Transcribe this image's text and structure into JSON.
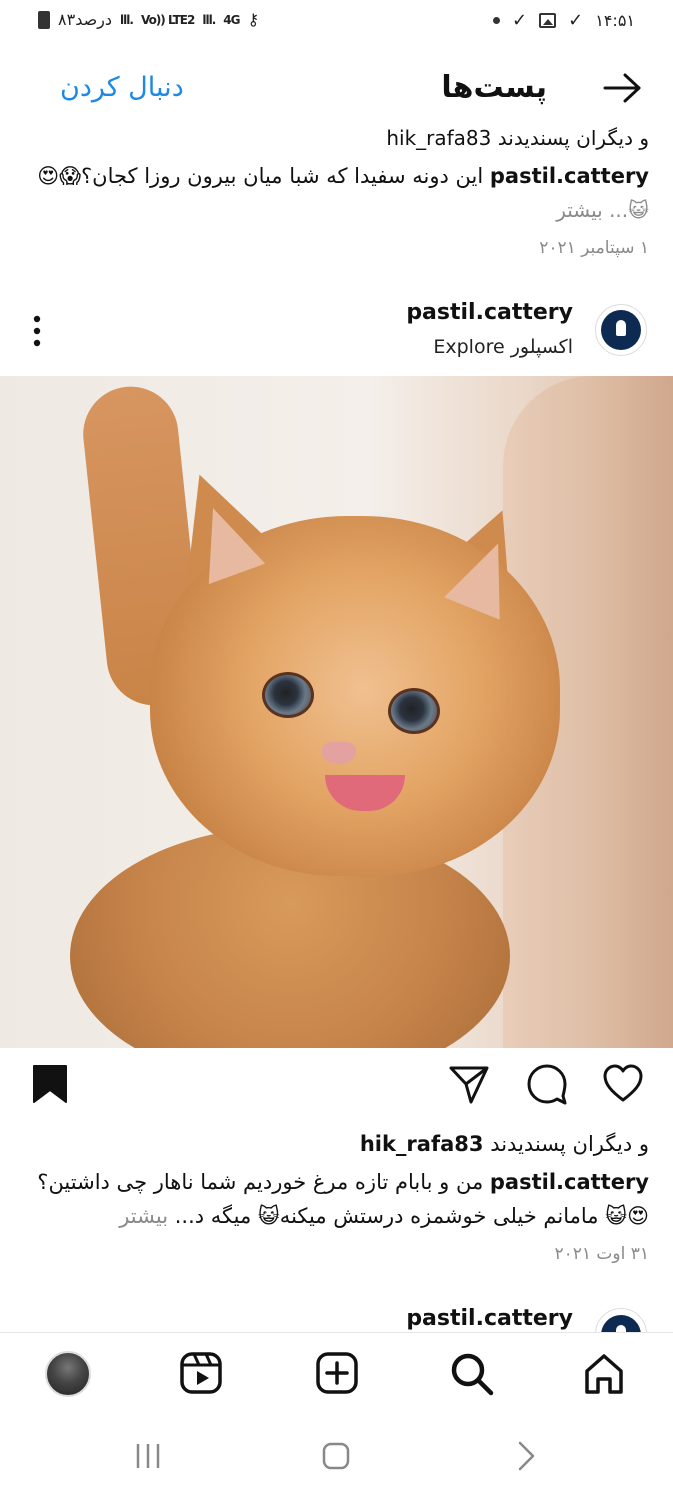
{
  "status_bar": {
    "battery": "۸۳درصد",
    "network_4g": "4G",
    "volte": "Vo)) LTE2",
    "time": "۱۴:۵۱",
    "icons": [
      "battery-icon",
      "signal-icon",
      "volte-icon",
      "4g-icon",
      "key-icon",
      "dot-icon",
      "check-icon",
      "gallery-icon",
      "check-icon"
    ]
  },
  "header": {
    "title": "پست‌ها",
    "follow_label": "دنبال کردن",
    "back_icon": "arrow-right-icon"
  },
  "prev_post": {
    "likes_partial": "و دیگران پسندیدند hik_rafa83",
    "caption_user": "pastil.cattery",
    "caption_text": "این دونه سفیدا که شبا میان بیرون روزا کجان؟😱😍",
    "caption_more": "😺... بیشتر",
    "date": "۱ سپتامبر ۲۰۲۱"
  },
  "post": {
    "username": "pastil.cattery",
    "location": "اکسپلور Explore",
    "avatar_label": "pastil.cattery",
    "likes_text": "و دیگران پسندیدند",
    "likes_user": "hik_rafa83",
    "caption_user": "pastil.cattery",
    "caption_line1": "من و بابام تازه مرغ خوردیم شما ناهار چی داشتین؟",
    "caption_line2": "😍😺 مامانم خیلی خوشمزه درستش میکنه😺 میگه د...",
    "caption_more": "بیشتر",
    "date": "۳۱ اوت ۲۰۲۱"
  },
  "next_post": {
    "username": "pastil.cattery"
  },
  "colors": {
    "accent_blue": "#1e88e5",
    "text": "#111111",
    "muted": "#8a8a8a"
  }
}
